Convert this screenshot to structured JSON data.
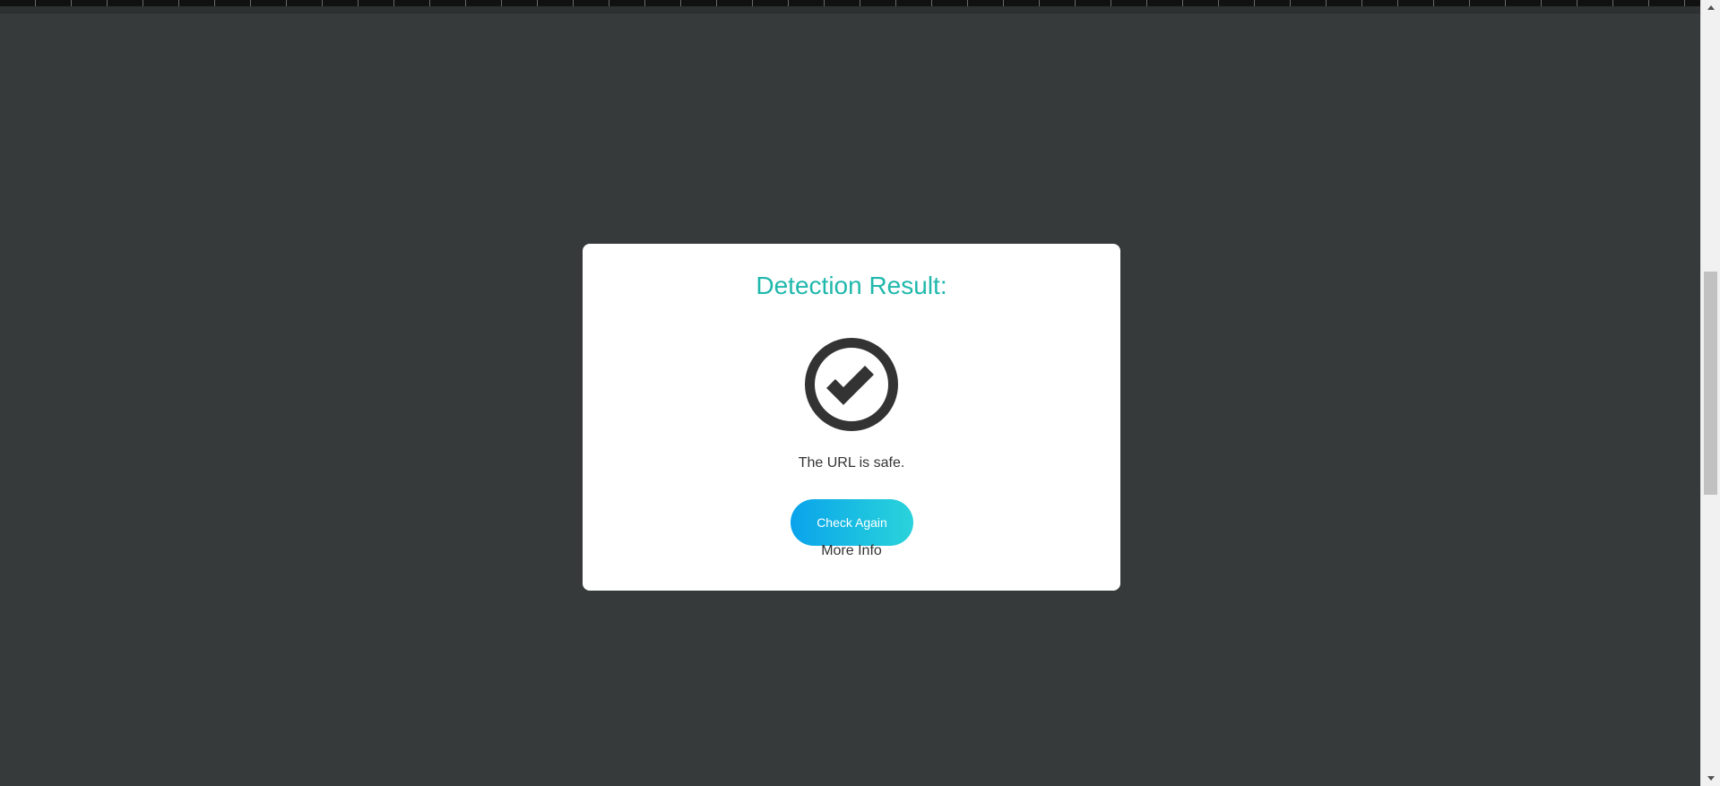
{
  "modal": {
    "title": "Detection Result:",
    "icon": "check-circle-icon",
    "message": "The URL is safe.",
    "check_again_label": "Check Again",
    "more_info_label": "More Info"
  },
  "colors": {
    "background": "#363a3b",
    "title": "#20b8ac",
    "icon": "#333333",
    "button_gradient_start": "#0aa3ec",
    "button_gradient_end": "#2ad3db"
  }
}
